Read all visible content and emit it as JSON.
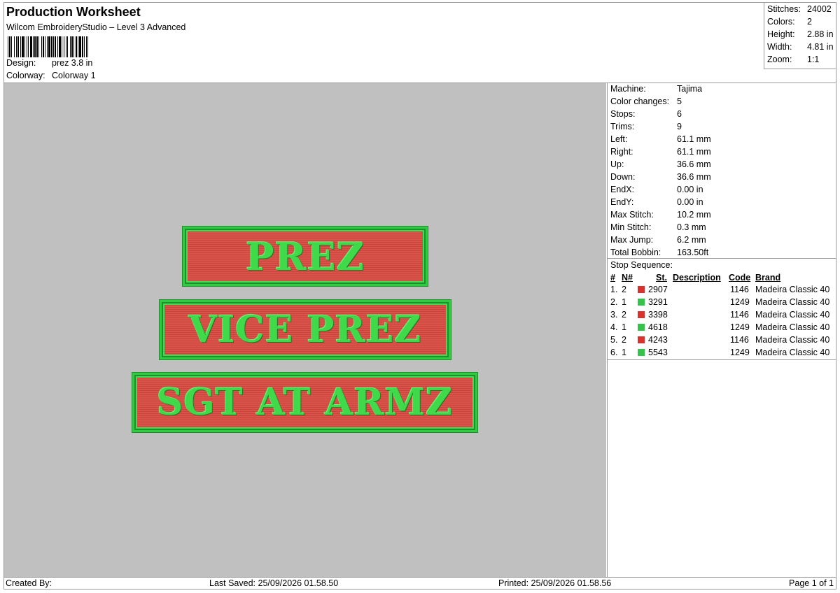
{
  "header": {
    "title": "Production Worksheet",
    "subtitle": "Wilcom EmbroideryStudio – Level 3 Advanced",
    "design_label": "Design:",
    "design_value": "prez 3.8 in",
    "colorway_label": "Colorway:",
    "colorway_value": "Colorway 1"
  },
  "stats": [
    {
      "label": "Stitches:",
      "value": "24002"
    },
    {
      "label": "Colors:",
      "value": "2"
    },
    {
      "label": "Height:",
      "value": "2.88 in"
    },
    {
      "label": "Width:",
      "value": "4.81 in"
    },
    {
      "label": "Zoom:",
      "value": "1:1"
    }
  ],
  "design_preview": {
    "patches": [
      "PREZ",
      "VICE PREZ",
      "SGT AT ARMZ"
    ],
    "thread_colors": {
      "red": "#d9534a",
      "green": "#2ecc40"
    },
    "background": "#c0c0c0"
  },
  "machine_info": [
    {
      "label": "Machine:",
      "value": "Tajima"
    },
    {
      "label": "Color changes:",
      "value": "5"
    },
    {
      "label": "Stops:",
      "value": "6"
    },
    {
      "label": "Trims:",
      "value": "9"
    },
    {
      "label": "Left:",
      "value": "61.1 mm"
    },
    {
      "label": "Right:",
      "value": "61.1 mm"
    },
    {
      "label": "Up:",
      "value": "36.6 mm"
    },
    {
      "label": "Down:",
      "value": "36.6 mm"
    },
    {
      "label": "EndX:",
      "value": "0.00 in"
    },
    {
      "label": "EndY:",
      "value": "0.00 in"
    },
    {
      "label": "Max Stitch:",
      "value": "10.2 mm"
    },
    {
      "label": "Min Stitch:",
      "value": "0.3 mm"
    },
    {
      "label": "Max Jump:",
      "value": "6.2 mm"
    },
    {
      "label": "Total Bobbin:",
      "value": "163.50ft"
    }
  ],
  "stop_sequence": {
    "title": "Stop Sequence:",
    "columns": [
      "#",
      "N#",
      "St.",
      "Description",
      "Code",
      "Brand"
    ],
    "rows": [
      {
        "num": "1.",
        "n": "2",
        "color": "#d9322c",
        "st": "2907",
        "desc": "",
        "code": "1146",
        "brand": "Madeira Classic 40"
      },
      {
        "num": "2.",
        "n": "1",
        "color": "#33c24a",
        "st": "3291",
        "desc": "",
        "code": "1249",
        "brand": "Madeira Classic 40"
      },
      {
        "num": "3.",
        "n": "2",
        "color": "#d9322c",
        "st": "3398",
        "desc": "",
        "code": "1146",
        "brand": "Madeira Classic 40"
      },
      {
        "num": "4.",
        "n": "1",
        "color": "#33c24a",
        "st": "4618",
        "desc": "",
        "code": "1249",
        "brand": "Madeira Classic 40"
      },
      {
        "num": "5.",
        "n": "2",
        "color": "#d9322c",
        "st": "4243",
        "desc": "",
        "code": "1146",
        "brand": "Madeira Classic 40"
      },
      {
        "num": "6.",
        "n": "1",
        "color": "#33c24a",
        "st": "5543",
        "desc": "",
        "code": "1249",
        "brand": "Madeira Classic 40"
      }
    ]
  },
  "footer": {
    "created_by": "Created By:",
    "last_saved": "Last Saved: 25/09/2026 01.58.50",
    "printed": "Printed: 25/09/2026 01.58.56",
    "page": "Page 1 of 1"
  }
}
